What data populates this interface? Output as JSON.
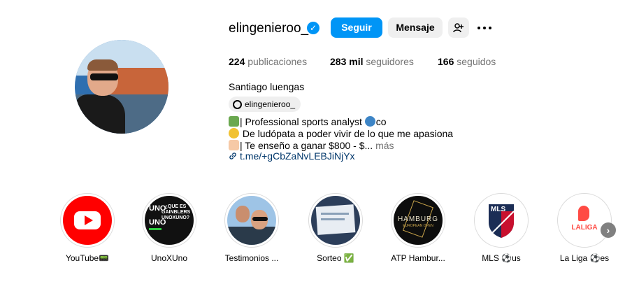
{
  "profile": {
    "username": "elingenieroo_",
    "verified_icon": "verified-badge-icon",
    "follow_label": "Seguir",
    "message_label": "Mensaje",
    "add_user_icon": "add-user-icon",
    "more_icon": "more-options-icon",
    "full_name": "Santiago luengas",
    "threads_handle": "elingenieroo_"
  },
  "stats": {
    "posts_count": "224",
    "posts_label": "publicaciones",
    "followers_count": "283 mil",
    "followers_label": "seguidores",
    "following_count": "166",
    "following_label": "seguidos"
  },
  "bio": {
    "line1": "| Professional sports analyst ",
    "line1_end": "co",
    "line2": " De ludópata a poder vivir de lo que me apasiona",
    "line3": "| Te enseño a ganar $800 - $... ",
    "more_label": "más",
    "link": "t.me/+gCbZaNvLEBJiNjYx"
  },
  "highlights": [
    {
      "label": "YouTube📟"
    },
    {
      "label": "UnoXUno"
    },
    {
      "label": "Testimonios ..."
    },
    {
      "label": "Sorteo ✅"
    },
    {
      "label": "ATP Hambur..."
    },
    {
      "label": "MLS ⚽us"
    },
    {
      "label": "La Liga ⚽es"
    }
  ],
  "highlight_texts": {
    "unoxuno_top": "UNO",
    "unoxuno_mid": "¿QUE ES GAINBLERS UNOXUNO?",
    "unoxuno_bot": "UNO",
    "hamburg_line1": "HAMBURG",
    "hamburg_line2": "EUROPEAN OPEN",
    "mls_text": "MLS",
    "laliga_text": "LALIGA"
  },
  "colors": {
    "primary_blue": "#0095f6",
    "link_blue": "#00376b",
    "secondary_text": "#737373",
    "button_gray": "#efefef"
  }
}
